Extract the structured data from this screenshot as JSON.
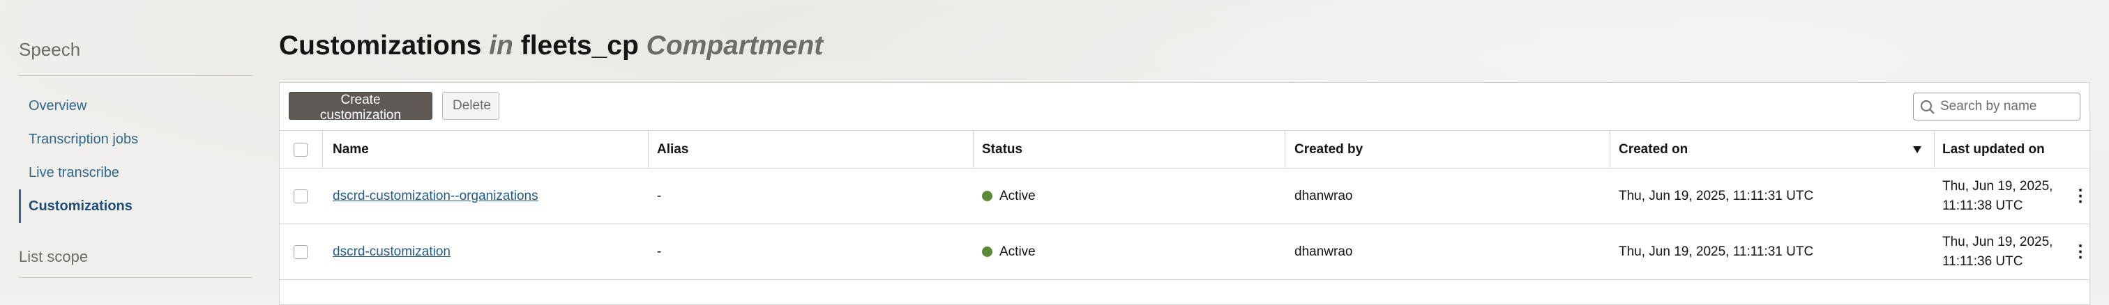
{
  "sidebar": {
    "title": "Speech",
    "items": [
      {
        "label": "Overview"
      },
      {
        "label": "Transcription jobs"
      },
      {
        "label": "Live transcribe"
      },
      {
        "label": "Customizations"
      }
    ],
    "scope_label": "List scope"
  },
  "page": {
    "title_main": "Customizations",
    "title_in": "in",
    "compartment": "fleets_cp",
    "compartment_suffix": "Compartment"
  },
  "toolbar": {
    "create_label": "Create customization",
    "delete_label": "Delete",
    "search_placeholder": "Search by name"
  },
  "table": {
    "columns": [
      "Name",
      "Alias",
      "Status",
      "Created by",
      "Created on",
      "Last updated on"
    ],
    "sorted_column": "Created on",
    "sort_direction": "descending",
    "rows": [
      {
        "name": "dscrd-customization--organizations",
        "alias": "-",
        "status": "Active",
        "created_by": "dhanwrao",
        "created_on": "Thu, Jun 19, 2025, 11:11:31 UTC",
        "updated_line1": "Thu, Jun 19, 2025,",
        "updated_line2": "11:11:38 UTC"
      },
      {
        "name": "dscrd-customization",
        "alias": "-",
        "status": "Active",
        "created_by": "dhanwrao",
        "created_on": "Thu, Jun 19, 2025, 11:11:31 UTC",
        "updated_line1": "Thu, Jun 19, 2025,",
        "updated_line2": "11:11:36 UTC"
      }
    ]
  },
  "colors": {
    "status_active": "#5b8a34",
    "link": "#1f5b8f",
    "primary_button": "#5e5954"
  }
}
